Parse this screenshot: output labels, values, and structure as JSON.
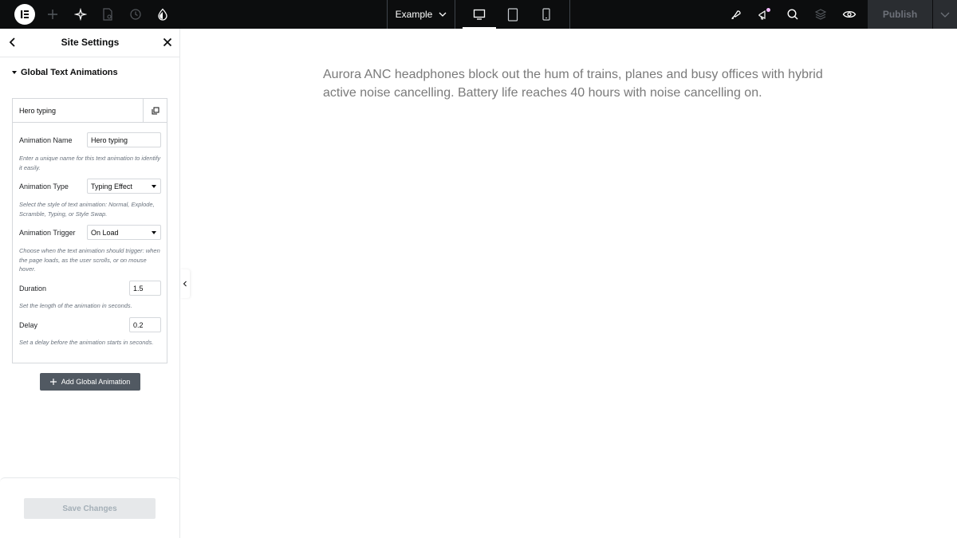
{
  "topbar": {
    "page_name": "Example",
    "publish_label": "Publish",
    "icons": [
      "elementor-logo-icon",
      "add-element-icon",
      "ai-sparkle-icon",
      "page-settings-icon",
      "history-icon",
      "theme-style-icon",
      "page-dropdown-chevron-icon",
      "desktop-icon",
      "tablet-icon",
      "mobile-icon",
      "site-settings-icon",
      "whats-new-icon",
      "search-icon",
      "structure-layers-icon",
      "preview-eye-icon",
      "publish-options-chevron-icon"
    ],
    "devices": [
      "Desktop",
      "Tablet",
      "Mobile"
    ],
    "active_device": "Desktop",
    "notification_dot_color": "#f3bafd"
  },
  "panel": {
    "title": "Site Settings",
    "section_title": "Global Text Animations",
    "repeater_item_title": "Hero typing",
    "fields": {
      "name": {
        "label": "Animation Name",
        "value": "Hero typing",
        "desc": "Enter a unique name for this text animation to identify it easily."
      },
      "type": {
        "label": "Animation Type",
        "value": "Typing Effect",
        "desc": "Select the style of text animation: Normal, Explode, Scramble, Typing, or Style Swap."
      },
      "trigger": {
        "label": "Animation Trigger",
        "value": "On Load",
        "desc": "Choose when the text animation should trigger: when the page loads, as the user scrolls, or on mouse hover."
      },
      "duration": {
        "label": "Duration",
        "value": "1.5",
        "desc": "Set the length of the animation in seconds."
      },
      "delay": {
        "label": "Delay",
        "value": "0.2",
        "desc": "Set a delay before the animation starts in seconds."
      }
    },
    "add_button_label": "Add Global Animation",
    "save_button_label": "Save Changes"
  },
  "canvas": {
    "text": "Aurora ANC headphones block out the hum of trains, planes and busy offices with hybrid active noise cancelling. Battery life reaches 40 hours with noise cancelling on."
  }
}
